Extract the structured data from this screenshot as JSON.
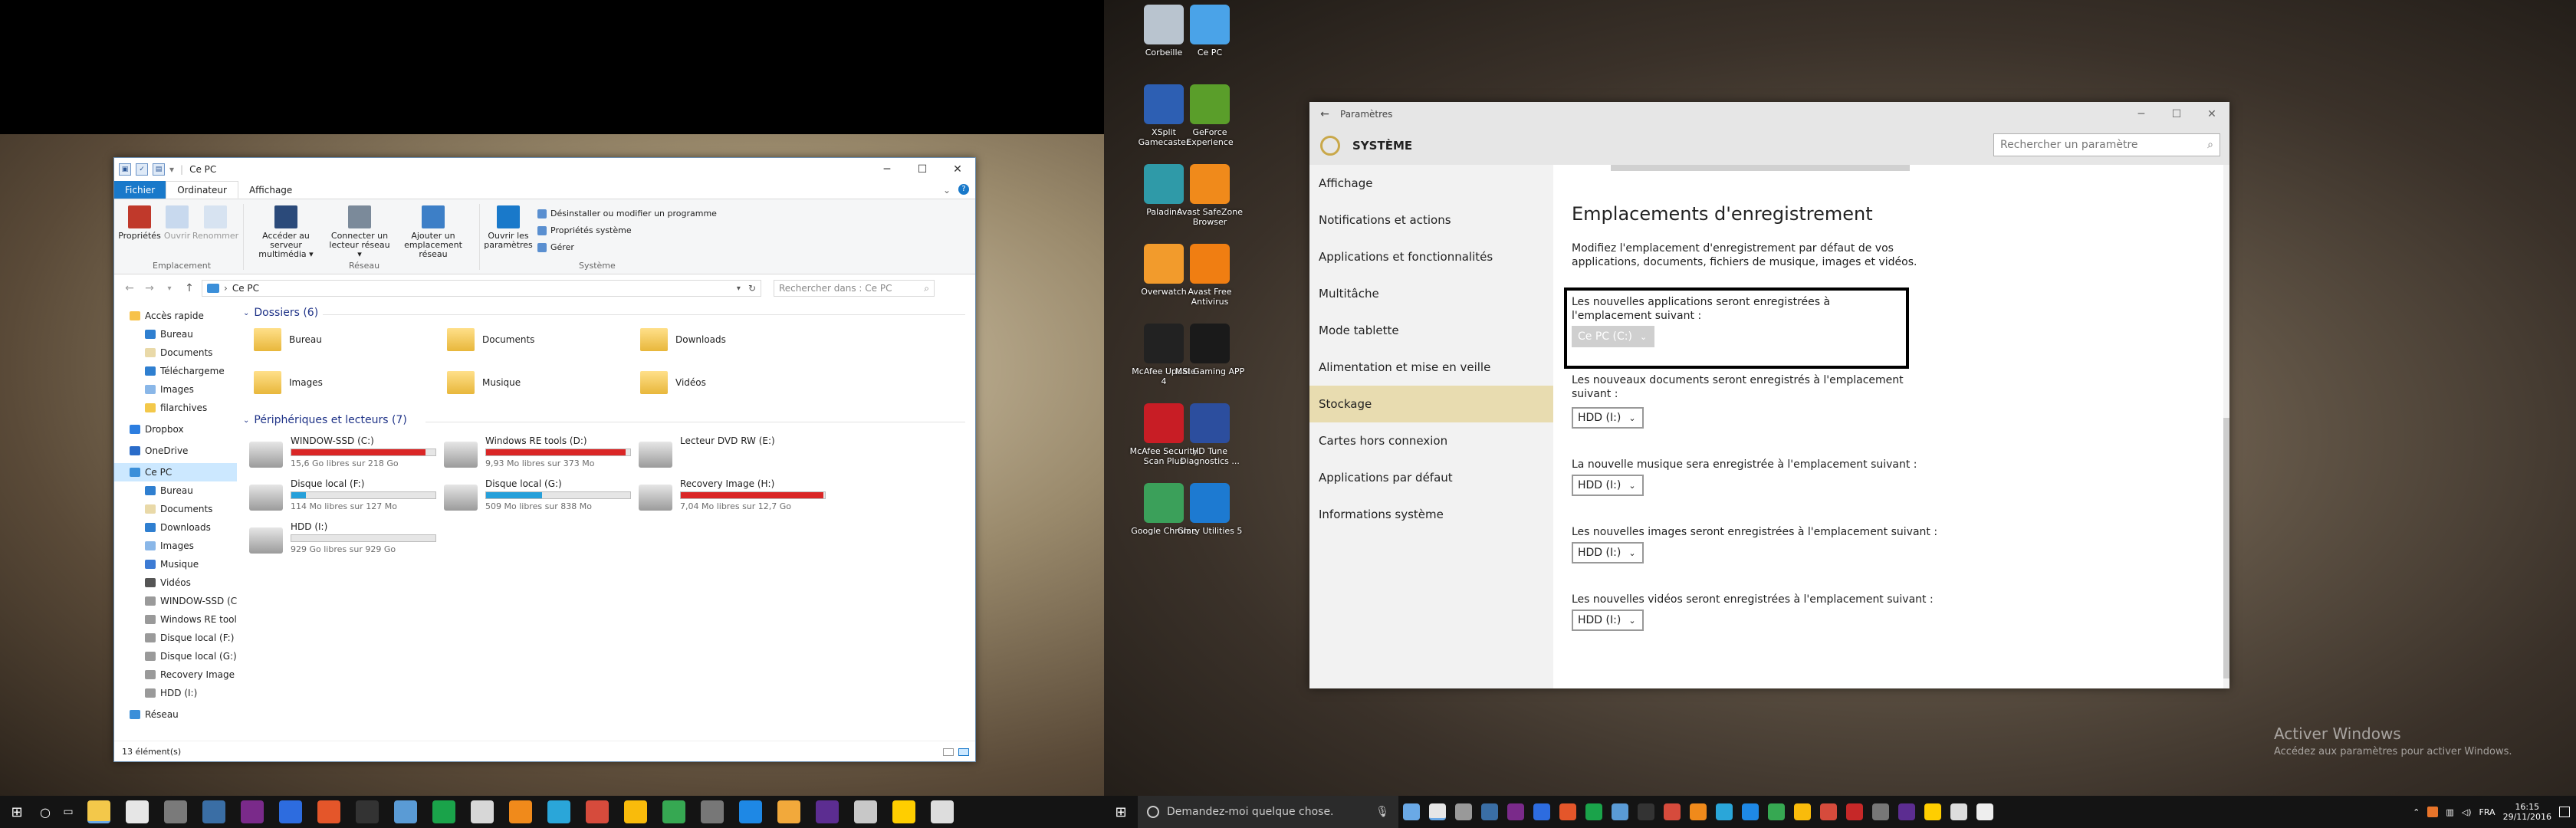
{
  "explorer": {
    "title": "Ce PC",
    "tabs": [
      "Fichier",
      "Ordinateur",
      "Affichage"
    ],
    "ribbon": {
      "emplacement": {
        "group": "Emplacement",
        "buttons": [
          "Propriétés",
          "Ouvrir",
          "Renommer"
        ]
      },
      "reseau": {
        "group": "Réseau",
        "buttons": [
          "Accéder au serveur multimédia ▾",
          "Connecter un lecteur réseau ▾",
          "Ajouter un emplacement réseau"
        ]
      },
      "systeme": {
        "group": "Système",
        "open_label": "Ouvrir les paramètres",
        "items": [
          "Désinstaller ou modifier un programme",
          "Propriétés système",
          "Gérer"
        ]
      }
    },
    "address": "Ce PC",
    "search_placeholder": "Rechercher dans : Ce PC",
    "nav": [
      {
        "label": "Accès rapide",
        "icon": "star-icon",
        "color": "#f7c24a",
        "indent": 0
      },
      {
        "label": "Bureau",
        "icon": "desktop-folder-icon",
        "color": "#2f7fd0",
        "indent": 1
      },
      {
        "label": "Documents",
        "icon": "documents-folder-icon",
        "color": "#e9d9a8",
        "indent": 1
      },
      {
        "label": "Téléchargeme",
        "icon": "downloads-folder-icon",
        "color": "#2f7fd0",
        "indent": 1
      },
      {
        "label": "Images",
        "icon": "images-folder-icon",
        "color": "#8ab7e8",
        "indent": 1
      },
      {
        "label": "filarchives",
        "icon": "folder-icon",
        "color": "#f3c84a",
        "indent": 1
      },
      {
        "label": "Dropbox",
        "icon": "dropbox-icon",
        "color": "#2d7ee0",
        "indent": 0
      },
      {
        "label": "OneDrive",
        "icon": "onedrive-icon",
        "color": "#2a6cc9",
        "indent": 0
      },
      {
        "label": "Ce PC",
        "icon": "pc-icon",
        "color": "#3b8fd9",
        "indent": 0,
        "selected": true
      },
      {
        "label": "Bureau",
        "icon": "desktop-folder-icon",
        "color": "#2f7fd0",
        "indent": 1
      },
      {
        "label": "Documents",
        "icon": "documents-folder-icon",
        "color": "#e9d9a8",
        "indent": 1
      },
      {
        "label": "Downloads",
        "icon": "downloads-folder-icon",
        "color": "#2f7fd0",
        "indent": 1
      },
      {
        "label": "Images",
        "icon": "images-folder-icon",
        "color": "#8ab7e8",
        "indent": 1
      },
      {
        "label": "Musique",
        "icon": "music-icon",
        "color": "#3d7bd4",
        "indent": 1
      },
      {
        "label": "Vidéos",
        "icon": "video-icon",
        "color": "#555555",
        "indent": 1
      },
      {
        "label": "WINDOW-SSD (C:)",
        "icon": "drive-icon",
        "color": "#9a9a9a",
        "indent": 1
      },
      {
        "label": "Windows RE tools (",
        "icon": "drive-icon",
        "color": "#9a9a9a",
        "indent": 1
      },
      {
        "label": "Disque local (F:)",
        "icon": "drive-icon",
        "color": "#9a9a9a",
        "indent": 1
      },
      {
        "label": "Disque local (G:)",
        "icon": "drive-icon",
        "color": "#9a9a9a",
        "indent": 1
      },
      {
        "label": "Recovery Image (H:",
        "icon": "drive-icon",
        "color": "#9a9a9a",
        "indent": 1
      },
      {
        "label": "HDD (I:)",
        "icon": "drive-icon",
        "color": "#9a9a9a",
        "indent": 1
      },
      {
        "label": "Réseau",
        "icon": "network-icon",
        "color": "#3b8fd9",
        "indent": 0
      }
    ],
    "folders_header": "Dossiers (6)",
    "folders": [
      "Bureau",
      "Documents",
      "Downloads",
      "Images",
      "Musique",
      "Vidéos"
    ],
    "drives_header": "Périphériques et lecteurs (7)",
    "drives": [
      {
        "name": "WINDOW-SSD (C:)",
        "free": "15,6 Go libres sur 218 Go",
        "used": 0.93,
        "color": "#da2626"
      },
      {
        "name": "Windows RE tools (D:)",
        "free": "9,93 Mo libres sur 373 Mo",
        "used": 0.97,
        "color": "#da2626"
      },
      {
        "name": "Lecteur DVD RW (E:)",
        "free": "",
        "used": null,
        "color": ""
      },
      {
        "name": "Disque local (F:)",
        "free": "114 Mo libres sur 127 Mo",
        "used": 0.1,
        "color": "#26a0da"
      },
      {
        "name": "Disque local (G:)",
        "free": "509 Mo libres sur 838 Mo",
        "used": 0.39,
        "color": "#26a0da"
      },
      {
        "name": "Recovery Image (H:)",
        "free": "7,04 Mo libres sur 12,7 Go",
        "used": 0.99,
        "color": "#da2626"
      },
      {
        "name": "HDD (I:)",
        "free": "929 Go libres sur 929 Go",
        "used": 0.0,
        "color": "#26a0da"
      }
    ],
    "status": "13 élément(s)"
  },
  "settings": {
    "title": "Paramètres",
    "section": "SYSTÈME",
    "search_placeholder": "Rechercher un paramètre",
    "nav": [
      "Affichage",
      "Notifications et actions",
      "Applications et fonctionnalités",
      "Multitâche",
      "Mode tablette",
      "Alimentation et mise en veille",
      "Stockage",
      "Cartes hors connexion",
      "Applications par défaut",
      "Informations système"
    ],
    "heading": "Emplacements d'enregistrement",
    "description": "Modifiez l'emplacement d'enregistrement par défaut de vos applications, documents, fichiers de musique, images et vidéos.",
    "apps_label": "Les nouvelles applications seront enregistrées à l'emplacement suivant :",
    "apps_value": "Ce PC (C:)",
    "docs_label": "Les nouveaux documents seront enregistrés à l'emplacement suivant :",
    "docs_value": "HDD (I:)",
    "music_label": "La nouvelle musique sera enregistrée à l'emplacement suivant :",
    "music_value": "HDD (I:)",
    "images_label": "Les nouvelles images seront enregistrées à l'emplacement suivant :",
    "images_value": "HDD (I:)",
    "videos_label": "Les nouvelles vidéos seront enregistrées à l'emplacement suivant :",
    "videos_value": "HDD (I:)"
  },
  "desktop_icons": [
    {
      "label": "Corbeille",
      "icon": "recycle-bin-icon",
      "color": "#b9c4cf"
    },
    {
      "label": "Ce PC",
      "icon": "pc-icon",
      "color": "#4aa3e8"
    },
    {
      "label": "XSplit Gamecaster",
      "icon": "xsplit-icon",
      "color": "#2d5fb3"
    },
    {
      "label": "GeForce Experience",
      "icon": "geforce-icon",
      "color": "#5a9e2a"
    },
    {
      "label": "Paladins",
      "icon": "paladins-icon",
      "color": "#2f9aa8"
    },
    {
      "label": "Avast SafeZone Browser",
      "icon": "avast-icon",
      "color": "#f08a1b"
    },
    {
      "label": "Overwatch",
      "icon": "overwatch-icon",
      "color": "#f29b2c"
    },
    {
      "label": "Avast Free Antivirus",
      "icon": "avast-icon",
      "color": "#f07e12"
    },
    {
      "label": "McAfee Update 4",
      "icon": "mcafee-icon",
      "color": "#222222"
    },
    {
      "label": "MSI Gaming APP",
      "icon": "msi-icon",
      "color": "#1a1a1a"
    },
    {
      "label": "McAfee Security Scan Plus",
      "icon": "mcafee-icon",
      "color": "#c81d25"
    },
    {
      "label": "HD Tune Diagnostics ...",
      "icon": "hd-tune-icon",
      "color": "#2c4e9e"
    },
    {
      "label": "Google Chrome",
      "icon": "chrome-icon",
      "color": "#3ba05a"
    },
    {
      "label": "Glary Utilities 5",
      "icon": "glary-icon",
      "color": "#1d7ad1"
    }
  ],
  "watermark": {
    "title": "Activer Windows",
    "subtitle": "Accédez aux paramètres pour activer Windows."
  },
  "taskbar": {
    "search_placeholder": "Demandez-moi quelque chose.",
    "language": "FRA",
    "time": "16:15",
    "date": "29/11/2016"
  }
}
